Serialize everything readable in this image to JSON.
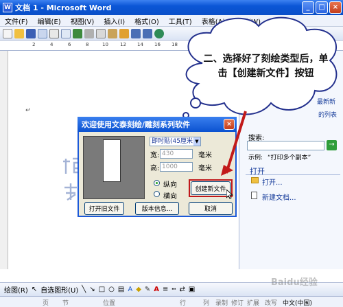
{
  "window": {
    "title": "文档 1 - Microsoft Word"
  },
  "menu": {
    "items": [
      "文件(F)",
      "编辑(E)",
      "视图(V)",
      "插入(I)",
      "格式(O)",
      "工具(T)",
      "表格(A)",
      "窗口(W)",
      "帮助(H)"
    ]
  },
  "ruler": {
    "numbers": [
      "2",
      "4",
      "6",
      "8",
      "10",
      "12",
      "14",
      "16",
      "18",
      "20",
      "22"
    ]
  },
  "callout": {
    "text": "二、选择好了刻绘类型后，单击【创建新文件】按钮"
  },
  "dialog": {
    "title": "欢迎使用文泰刻绘/雕刻系列软件",
    "type_select": "即时贴(45厘米)",
    "width_label": "宽:",
    "width_value": "430",
    "height_label": "高:",
    "height_value": "1000",
    "unit": "毫米",
    "portrait": "纵向",
    "landscape": "横向",
    "create_button": "创建新文件",
    "open_button": "打开旧文件",
    "version_button": "版本信息...",
    "cancel_button": "取消"
  },
  "taskpane": {
    "partial_1": "ce",
    "partial_2": "最新新",
    "partial_3": "的列表",
    "search_label": "搜索:",
    "example_label": "示例:",
    "example_value": "“打印多个副本”",
    "open_heading": "打开",
    "open_link": "打开...",
    "new_doc_link": "新建文档..."
  },
  "drawbar": {
    "draw_label": "绘图(R)",
    "autoshape_label": "自选图形(U)"
  },
  "statusbar": {
    "page": "页",
    "section": "节",
    "position": "位置",
    "line": "行",
    "column": "列",
    "rec": "录制",
    "trk": "修订",
    "ext": "扩展",
    "ovr": "改写",
    "lang": "中文(中国)"
  },
  "watermark": {
    "text": "Baidu经验"
  },
  "colors": {
    "xp_blue": "#0b56d6",
    "dialog_bg": "#ece9d8",
    "highlight_red": "#c0181b",
    "arrow_red": "#c21a1a"
  }
}
